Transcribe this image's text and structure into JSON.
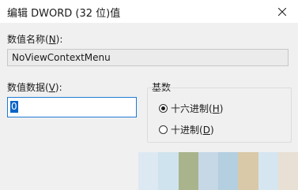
{
  "title": "编辑 DWORD (32 位)值",
  "value_name": {
    "label_prefix": "数值名称(",
    "label_key": "N",
    "label_suffix": "):",
    "value": "NoViewContextMenu"
  },
  "value_data": {
    "label_prefix": "数值数据(",
    "label_key": "V",
    "label_suffix": "):",
    "value": "0"
  },
  "base": {
    "label": "基数",
    "options": [
      {
        "prefix": "十六进制(",
        "key": "H",
        "suffix": ")",
        "checked": true
      },
      {
        "prefix": "十进制(",
        "key": "D",
        "suffix": ")",
        "checked": false
      }
    ]
  },
  "colors": {
    "accent": "#1f7ad4",
    "selection": "#0a64c8",
    "strip": [
      "#dde9f2",
      "#cfe3ee",
      "#a9b48c",
      "#c6d7e6",
      "#b3cfe0",
      "#d9c9a8",
      "#d6e6f0",
      "#e8e0d4"
    ]
  }
}
